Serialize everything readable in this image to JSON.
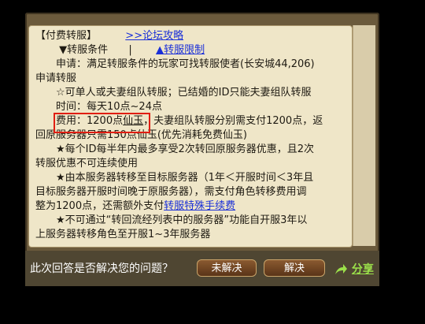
{
  "content": {
    "title": "【付费转服】",
    "forum_link": ">>论坛攻略",
    "tab_conditions": "▼转服条件",
    "tab_separator": "|",
    "tab_limits": "▲转服限制",
    "line1": "申请：满足转服条件的玩家可找转服使者(长安城44,206)",
    "line2": "申请转服",
    "line3": "☆可单人或夫妻组队转服；已结婚的ID只能夫妻组队转服",
    "line4": "时间：每天10点~24点",
    "line5_prefix": "费用：1200点",
    "line5_link": "仙玉",
    "line5_suffix": "，夫妻组队转服分别需支付1200点，返",
    "line6": "回原服务器只需150点仙玉(优先消耗免费仙玉)",
    "line7": "★每个ID每半年内最多享受2次转回原服务器优惠，且2次",
    "line8": "转服优惠不可连续使用",
    "line9": "★由本服务器转移至目标服务器（1年＜开服时间＜3年且",
    "line10": "目标服务器开服时间晚于原服务器），需支付角色转移费用调",
    "line11_prefix": "整为1200点，还需额外支付",
    "line11_link": "转服特殊手续费",
    "line12": "★不可通过“转回流经列表中的服务器”功能自开服3年以",
    "line13": "上服务器转移角色至开服1~3年服务器"
  },
  "feedback": {
    "question": "此次回答是否解决您的问题？",
    "unsolved": "未解决",
    "solved": "解决",
    "share": "分享"
  }
}
